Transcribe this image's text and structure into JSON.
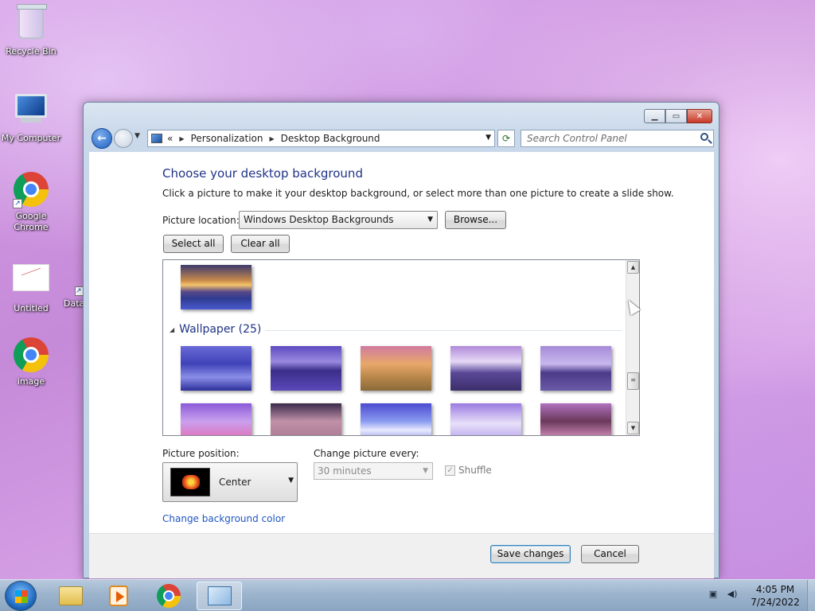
{
  "desktop": {
    "icons": [
      {
        "label": "Recycle Bin",
        "icon": "recycle-bin-icon"
      },
      {
        "label": "My Computer",
        "icon": "computer-icon"
      },
      {
        "label": "Google Chrome",
        "icon": "chrome-icon"
      },
      {
        "label": "Untitled",
        "icon": "document-icon"
      },
      {
        "label": "Data",
        "icon": "document-icon"
      },
      {
        "label": "image",
        "icon": "chrome-icon"
      }
    ]
  },
  "window": {
    "address": {
      "overflow": "«",
      "crumbs": [
        "Personalization",
        "Desktop Background"
      ]
    },
    "search_placeholder": "Search Control Panel",
    "heading": "Choose your desktop background",
    "instruction": "Click a picture to make it your desktop background, or select more than one picture to create a slide show.",
    "picture_location_label": "Picture location:",
    "picture_location_value": "Windows Desktop Backgrounds",
    "browse_label": "Browse...",
    "select_all_label": "Select all",
    "clear_all_label": "Clear all",
    "gallery": {
      "group_title": "Wallpaper (25)"
    },
    "picture_position_label": "Picture position:",
    "picture_position_value": "Center",
    "change_every_label": "Change picture every:",
    "change_every_value": "30 minutes",
    "shuffle_label": "Shuffle",
    "change_color_link": "Change background color",
    "save_label": "Save changes",
    "cancel_label": "Cancel"
  },
  "taskbar": {
    "time": "4:05 PM",
    "date": "7/24/2022"
  }
}
